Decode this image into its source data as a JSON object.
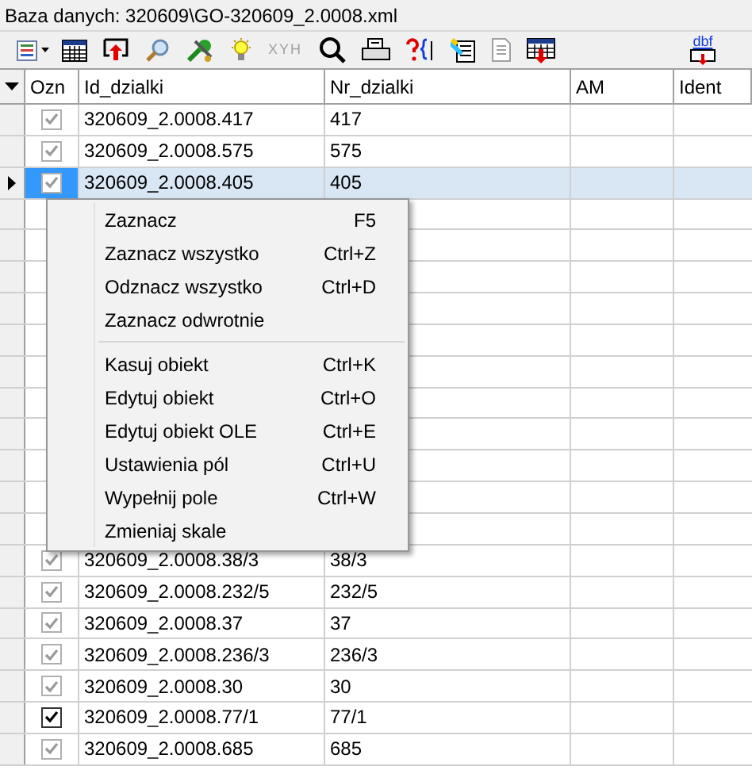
{
  "window": {
    "title": "Baza danych: 320609\\GO-320609_2.0008.xml"
  },
  "toolbar": [
    {
      "kind": "list"
    },
    {
      "kind": "grid"
    },
    {
      "kind": "export"
    },
    {
      "kind": "search"
    },
    {
      "kind": "tools"
    },
    {
      "kind": "bulb"
    },
    {
      "kind": "text",
      "label": "XYH",
      "disabled": true
    },
    {
      "kind": "zoom"
    },
    {
      "kind": "print"
    },
    {
      "kind": "query"
    },
    {
      "kind": "edit"
    },
    {
      "kind": "page",
      "disabled": true
    },
    {
      "kind": "export-grid"
    },
    {
      "kind": "spacer"
    },
    {
      "kind": "dbf",
      "label": "dbf"
    }
  ],
  "table": {
    "columns": [
      "Ozn",
      "Id_dzialki",
      "Nr_dzialki",
      "AM",
      "Ident"
    ],
    "rows": [
      {
        "id": "320609_2.0008.417",
        "nr": "417",
        "checked": true,
        "dimmed": true,
        "selected": false
      },
      {
        "id": "320609_2.0008.575",
        "nr": "575",
        "checked": true,
        "dimmed": true,
        "selected": false
      },
      {
        "id": "320609_2.0008.405",
        "nr": "405",
        "checked": true,
        "dimmed": true,
        "selected": true
      },
      {
        "kind": "covered"
      },
      {
        "kind": "covered"
      },
      {
        "kind": "covered"
      },
      {
        "kind": "covered"
      },
      {
        "kind": "covered"
      },
      {
        "kind": "covered"
      },
      {
        "kind": "covered"
      },
      {
        "kind": "covered"
      },
      {
        "kind": "covered"
      },
      {
        "kind": "covered"
      },
      {
        "kind": "covered"
      },
      {
        "id": "320609_2.0008.38/3",
        "nr": "38/3",
        "checked": true,
        "dimmed": true,
        "selected": false
      },
      {
        "id": "320609_2.0008.232/5",
        "nr": "232/5",
        "checked": true,
        "dimmed": true,
        "selected": false
      },
      {
        "id": "320609_2.0008.37",
        "nr": "37",
        "checked": true,
        "dimmed": true,
        "selected": false
      },
      {
        "id": "320609_2.0008.236/3",
        "nr": "236/3",
        "checked": true,
        "dimmed": true,
        "selected": false
      },
      {
        "id": "320609_2.0008.30",
        "nr": "30",
        "checked": true,
        "dimmed": true,
        "selected": false
      },
      {
        "id": "320609_2.0008.77/1",
        "nr": "77/1",
        "checked": true,
        "dimmed": false,
        "selected": false
      },
      {
        "id": "320609_2.0008.685",
        "nr": "685",
        "checked": true,
        "dimmed": true,
        "selected": false
      }
    ]
  },
  "context_menu": {
    "items": [
      {
        "kind": "item",
        "label": "Zaznacz",
        "shortcut": "F5"
      },
      {
        "kind": "item",
        "label": "Zaznacz wszystko",
        "shortcut": "Ctrl+Z"
      },
      {
        "kind": "item",
        "label": "Odznacz wszystko",
        "shortcut": "Ctrl+D"
      },
      {
        "kind": "item",
        "label": "Zaznacz odwrotnie"
      },
      {
        "kind": "separator"
      },
      {
        "kind": "item",
        "label": "Kasuj obiekt",
        "shortcut": "Ctrl+K"
      },
      {
        "kind": "item",
        "label": "Edytuj obiekt",
        "shortcut": "Ctrl+O"
      },
      {
        "kind": "item",
        "label": "Edytuj obiekt OLE",
        "shortcut": "Ctrl+E"
      },
      {
        "kind": "item",
        "label": "Ustawienia pól",
        "shortcut": "Ctrl+U"
      },
      {
        "kind": "item",
        "label": "Wypełnij pole",
        "shortcut": "Ctrl+W"
      },
      {
        "kind": "item",
        "label": "Zmieniaj skale"
      }
    ]
  }
}
